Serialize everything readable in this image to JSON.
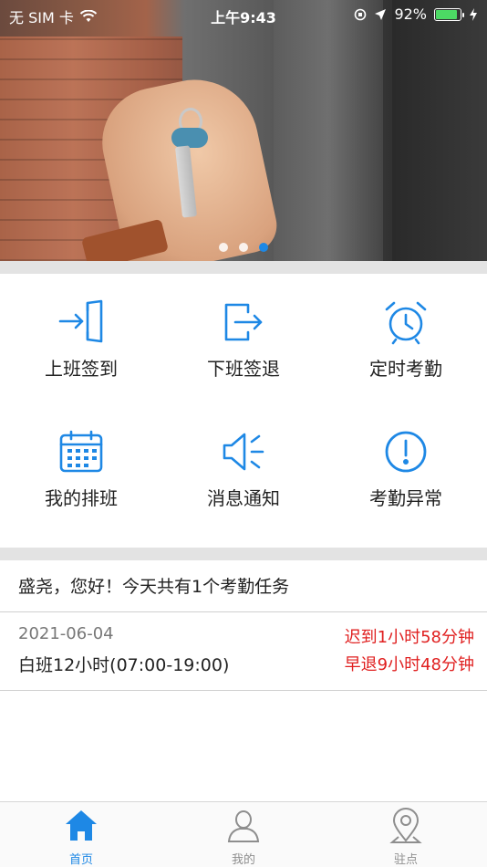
{
  "status_bar": {
    "carrier": "无 SIM 卡",
    "time": "上午9:43",
    "battery": "92%"
  },
  "banner": {
    "pages": 3,
    "active_page": 3
  },
  "features": [
    {
      "label": "上班签到",
      "icon": "sign-in-icon"
    },
    {
      "label": "下班签退",
      "icon": "sign-out-icon"
    },
    {
      "label": "定时考勤",
      "icon": "alarm-clock-icon"
    },
    {
      "label": "我的排班",
      "icon": "calendar-icon"
    },
    {
      "label": "消息通知",
      "icon": "speaker-icon"
    },
    {
      "label": "考勤异常",
      "icon": "exclamation-icon"
    }
  ],
  "greeting": "盛尧，您好！今天共有1个考勤任务",
  "task": {
    "date": "2021-06-04",
    "shift": "白班12小时(07:00-19:00)",
    "late": "迟到1小时58分钟",
    "early_leave": "早退9小时48分钟"
  },
  "tabs": [
    {
      "label": "首页",
      "icon": "home-icon",
      "active": true
    },
    {
      "label": "我的",
      "icon": "user-icon",
      "active": false
    },
    {
      "label": "驻点",
      "icon": "location-pin-icon",
      "active": false
    }
  ],
  "colors": {
    "accent": "#1e88e5",
    "alert": "#e02020",
    "battery": "#4cd964"
  }
}
